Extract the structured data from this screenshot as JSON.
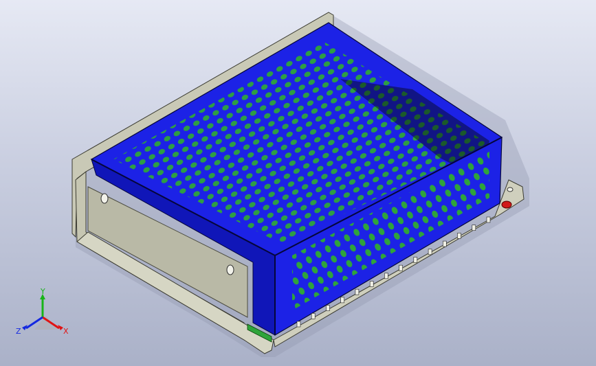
{
  "viewport": {
    "model": "perforated-enclosure-power-supply",
    "colors": {
      "background_top": "#e6e9f4",
      "background_bottom": "#aab1c8",
      "cover": "#1c22e6",
      "cover_dark": "#1016b8",
      "holes_far": "#c8cad8",
      "holes_mid": "#6a7a7a",
      "holes_near": "#2fa43a",
      "holes_dark": "#05060e",
      "chassis": "#c9c9b6",
      "chassis_dark": "#a6a694",
      "mount_red": "#d11a1a"
    }
  },
  "triad": {
    "x_label": "X",
    "y_label": "Y",
    "z_label": "Z",
    "colors": {
      "x": "#e01414",
      "y": "#18b418",
      "z": "#1428e0"
    }
  }
}
